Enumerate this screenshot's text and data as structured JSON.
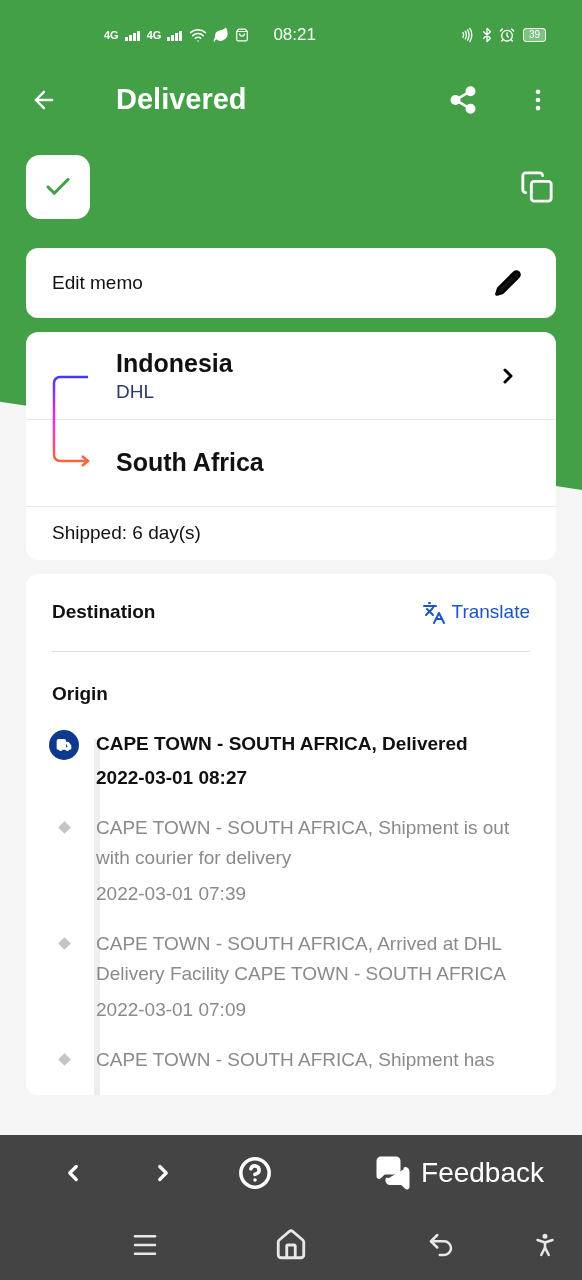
{
  "status_bar": {
    "network_1": "4G",
    "network_2": "4G",
    "time": "08:21",
    "battery": "39"
  },
  "app_bar": {
    "title": "Delivered"
  },
  "memo": {
    "label": "Edit memo"
  },
  "route": {
    "origin": "Indonesia",
    "carrier": "DHL",
    "destination": "South Africa",
    "shipped": "Shipped: 6 day(s)"
  },
  "details": {
    "heading": "Destination",
    "translate": "Translate",
    "section": "Origin",
    "events": [
      {
        "kind": "current",
        "text": "CAPE TOWN - SOUTH AFRICA, Delivered",
        "time": "2022-03-01 08:27"
      },
      {
        "kind": "past",
        "text": "CAPE TOWN - SOUTH AFRICA, Shipment is out with courier for delivery",
        "time": "2022-03-01 07:39"
      },
      {
        "kind": "past",
        "text": "CAPE TOWN - SOUTH AFRICA, Arrived at DHL Delivery Facility CAPE TOWN - SOUTH AFRICA",
        "time": "2022-03-01 07:09"
      },
      {
        "kind": "past",
        "text": "CAPE TOWN - SOUTH AFRICA, Shipment has"
      }
    ]
  },
  "bottom_bar": {
    "feedback": "Feedback"
  }
}
